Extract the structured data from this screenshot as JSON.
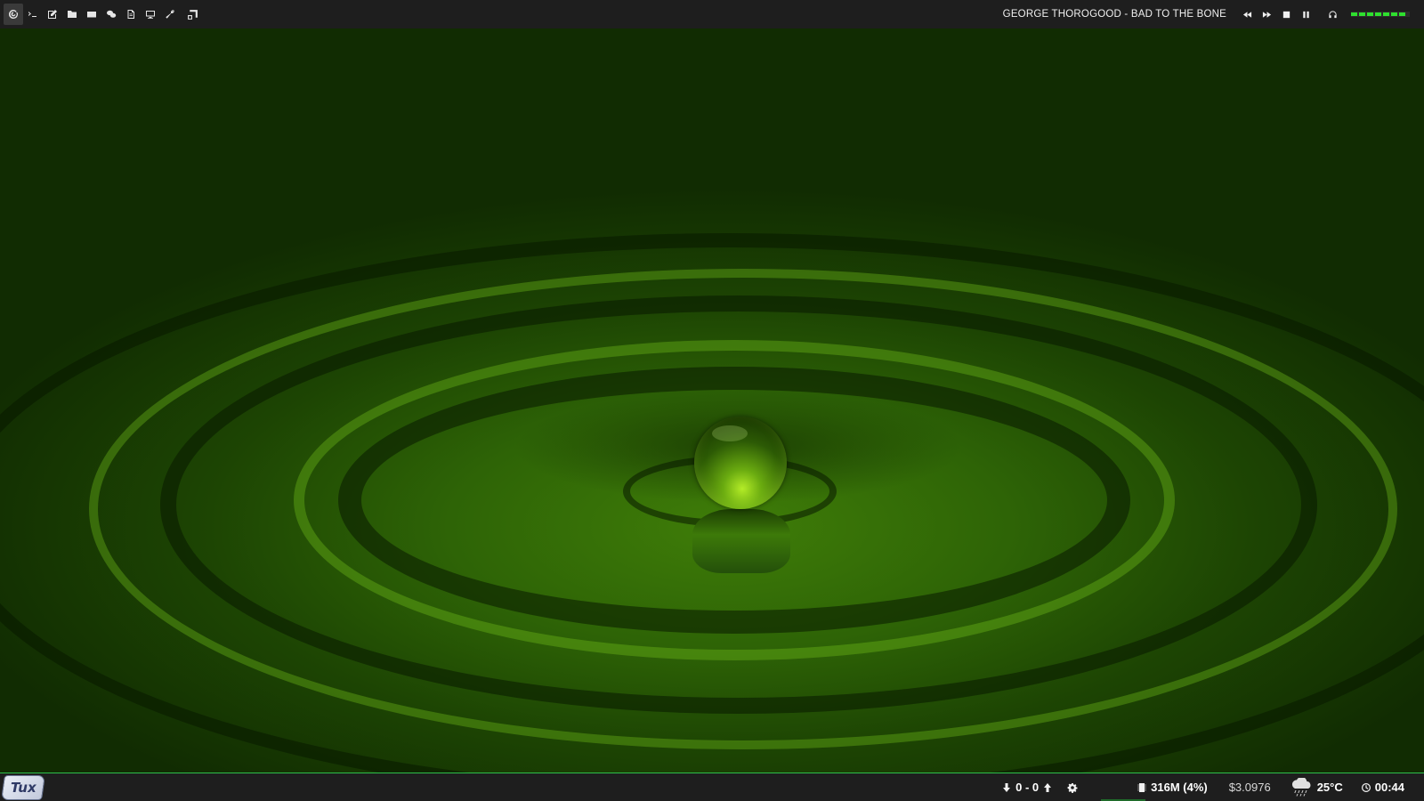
{
  "topbar": {
    "launchers": [
      {
        "name": "debian-icon",
        "glyph": "swirl"
      },
      {
        "name": "terminal-icon",
        "glyph": ">_"
      },
      {
        "name": "edit-icon",
        "glyph": "pencil"
      },
      {
        "name": "folder-icon",
        "glyph": "folder"
      },
      {
        "name": "mail-icon",
        "glyph": "envelope"
      },
      {
        "name": "chat-icon",
        "glyph": "bubbles"
      },
      {
        "name": "document-icon",
        "glyph": "file"
      },
      {
        "name": "monitor-icon",
        "glyph": "display"
      },
      {
        "name": "tools-icon",
        "glyph": "wrench"
      },
      {
        "name": "resize-window-icon",
        "glyph": "window"
      }
    ],
    "now_playing": "GEORGE THOROGOOD - BAD TO THE BONE",
    "media_controls": [
      "rewind",
      "fast-forward",
      "stop",
      "pause"
    ],
    "headphones_icon": "headphones-icon",
    "volume_level": 0.92,
    "volume_color": "#2ee02e"
  },
  "bottombar": {
    "logo_text": "Tux",
    "network": {
      "text": "0 - 0"
    },
    "memory": {
      "text": "316M (4%)"
    },
    "currency": {
      "text": "$3.0976"
    },
    "weather": {
      "text": "25°C",
      "icon": "rain-cloud-icon"
    },
    "clock": {
      "text": "00:44"
    },
    "accent_color": "#2dbf4b"
  }
}
